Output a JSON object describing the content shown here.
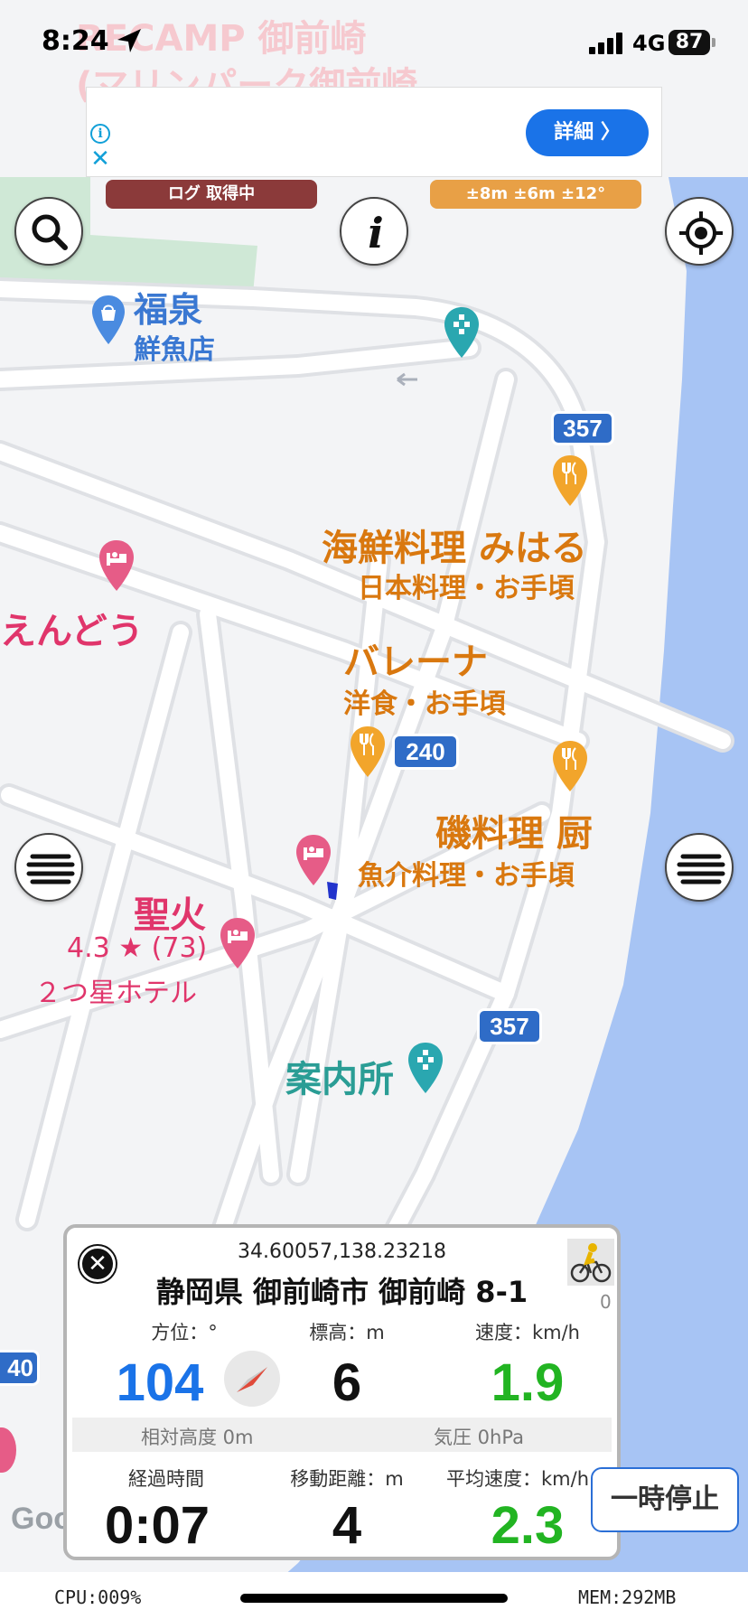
{
  "status_bar": {
    "time": "8:24",
    "network": "4G",
    "battery": "87"
  },
  "ad": {
    "button_label": "詳細 〉",
    "info_icon": "info-icon",
    "close_icon": "close-icon"
  },
  "indicators": {
    "log_status": "ログ 取得中",
    "accuracy": "±8m ±6m ±12°"
  },
  "map": {
    "background_text_line1": "RECAMP 御前崎",
    "background_text_line2": "(マリンパーク御前崎",
    "places": {
      "fukusen_name": "福泉",
      "fukusen_sub": "鮮魚店",
      "kaisen_name": "海鮮料理 みはる",
      "kaisen_sub": "日本料理・お手頃",
      "endou_name": "えんどう",
      "ballena_name": "バレーナ",
      "ballena_sub": "洋食・お手頃",
      "iso_name": "磯料理 厨",
      "iso_sub": "魚介料理・お手頃",
      "seika_name": "聖火",
      "seika_rating": "4.3 ★ (73)",
      "seika_class": "２つ星ホテル",
      "info_center": "案内所"
    },
    "route_shields": {
      "r357_top": "357",
      "r240": "240",
      "r357_bottom": "357",
      "r40_left": "40"
    },
    "google_logo": "Goog"
  },
  "panel": {
    "coordinates": "34.60057,138.23218",
    "address": "静岡県 御前崎市 御前崎 8-1",
    "count": "0",
    "heading_label": "方位：°",
    "heading_value": "104",
    "elevation_label": "標高：m",
    "elevation_value": "6",
    "speed_label": "速度：km/h",
    "speed_value": "1.9",
    "relative_height": "相対高度 0m",
    "pressure": "気圧 0hPa",
    "elapsed_label": "経過時間",
    "elapsed_value": "0:07",
    "distance_label": "移動距離：m",
    "distance_value": "4",
    "avg_speed_label": "平均速度：km/h",
    "avg_speed_value": "2.3"
  },
  "pause_button": "一時停止",
  "system": {
    "cpu": "CPU:009%",
    "mem": "MEM:292MB"
  },
  "colors": {
    "water": "#a7c4f4",
    "road": "#ffffff",
    "land": "#f3f4f6",
    "park": "#cfe8d6",
    "restaurant": "#d9780f",
    "hotel": "#e0356b",
    "info": "#2a9d95",
    "shop": "#3a78d2",
    "heading_blue": "#1a73e8",
    "speed_green": "#22b422",
    "shield": "#2f6cc7"
  }
}
